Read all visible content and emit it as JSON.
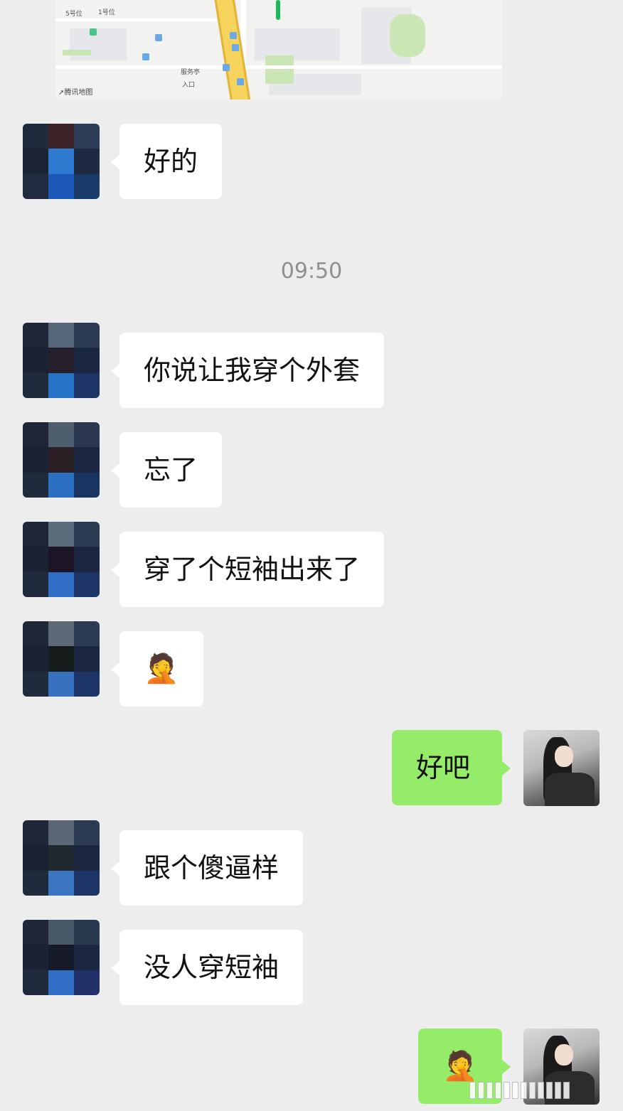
{
  "map": {
    "credit": "腾讯地图",
    "labels": [
      "5号位",
      "1号位",
      "服务亭",
      "入口"
    ]
  },
  "timestamp": "09:50",
  "colors": {
    "background": "#ededed",
    "incoming_bubble": "#ffffff",
    "outgoing_bubble": "#95ec69",
    "timestamp": "#8f8f8f"
  },
  "messages": [
    {
      "side": "in",
      "text": "好的"
    },
    {
      "side": "in",
      "text": "你说让我穿个外套"
    },
    {
      "side": "in",
      "text": "忘了"
    },
    {
      "side": "in",
      "text": "穿了个短袖出来了"
    },
    {
      "side": "in",
      "text": "🤦",
      "emoji_name": "facepalm-emoji"
    },
    {
      "side": "out",
      "text": "好吧"
    },
    {
      "side": "in",
      "text": "跟个傻逼样"
    },
    {
      "side": "in",
      "text": "没人穿短袖"
    },
    {
      "side": "out",
      "text": "🤦",
      "emoji_name": "facepalm-emoji"
    }
  ]
}
